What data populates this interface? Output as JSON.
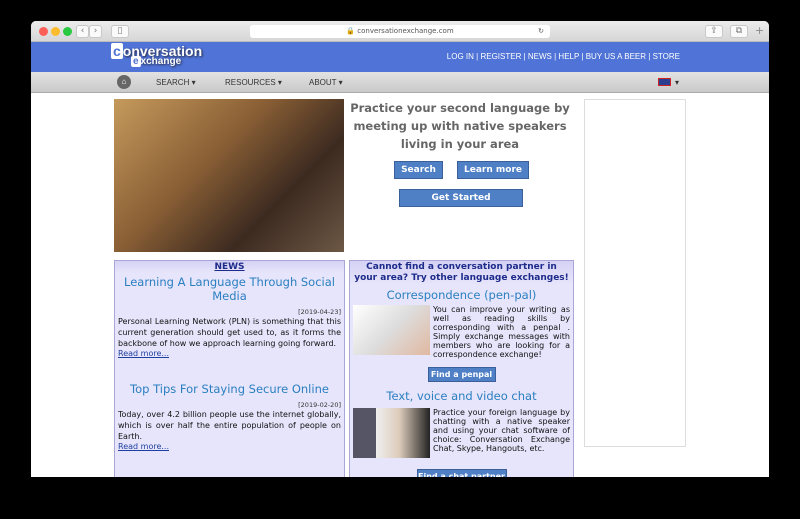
{
  "browser": {
    "url": "conversationexchange.com"
  },
  "header": {
    "logo_line1": "onversation",
    "logo_c": "c",
    "logo_line2": "xchange",
    "logo_e": "e",
    "links": [
      "LOG IN",
      "REGISTER",
      "NEWS",
      "HELP",
      "BUY US A BEER",
      "STORE"
    ]
  },
  "nav": {
    "items": [
      "SEARCH",
      "RESOURCES",
      "ABOUT"
    ]
  },
  "hero": {
    "tagline": "Practice your second language by meeting up with native speakers living in your area",
    "search": "Search",
    "learn_more": "Learn more",
    "get_started": "Get Started"
  },
  "news": {
    "heading": "NEWS",
    "items": [
      {
        "title": "Learning A Language Through Social Media",
        "date": "[2019-04-23]",
        "text": "Personal Learning Network (PLN) is something that this current generation should get used to, as it forms the backbone of how we approach learning going forward.",
        "more": "Read more..."
      },
      {
        "title": "Top Tips For Staying Secure Online",
        "date": "[2019-02-20]",
        "text": "Today, over 4.2 billion people use the internet globally, which is over half the entire population of people on Earth.",
        "more": "Read more..."
      }
    ]
  },
  "exchanges": {
    "heading": "Cannot find a conversation partner in your area? Try other language exchanges!",
    "items": [
      {
        "title": "Correspondence (pen-pal)",
        "text": "You can improve your writing as well as reading skills by corresponding with a penpal . Simply exchange messages with members who are looking for a correspondence exchange!",
        "button": "Find a penpal"
      },
      {
        "title": "Text, voice and video chat",
        "text": "Practice your foreign language by chatting with a native speaker and using your chat software of choice: Conversation Exchange Chat, Skype, Hangouts, etc.",
        "button": "Find a chat partner"
      }
    ]
  }
}
